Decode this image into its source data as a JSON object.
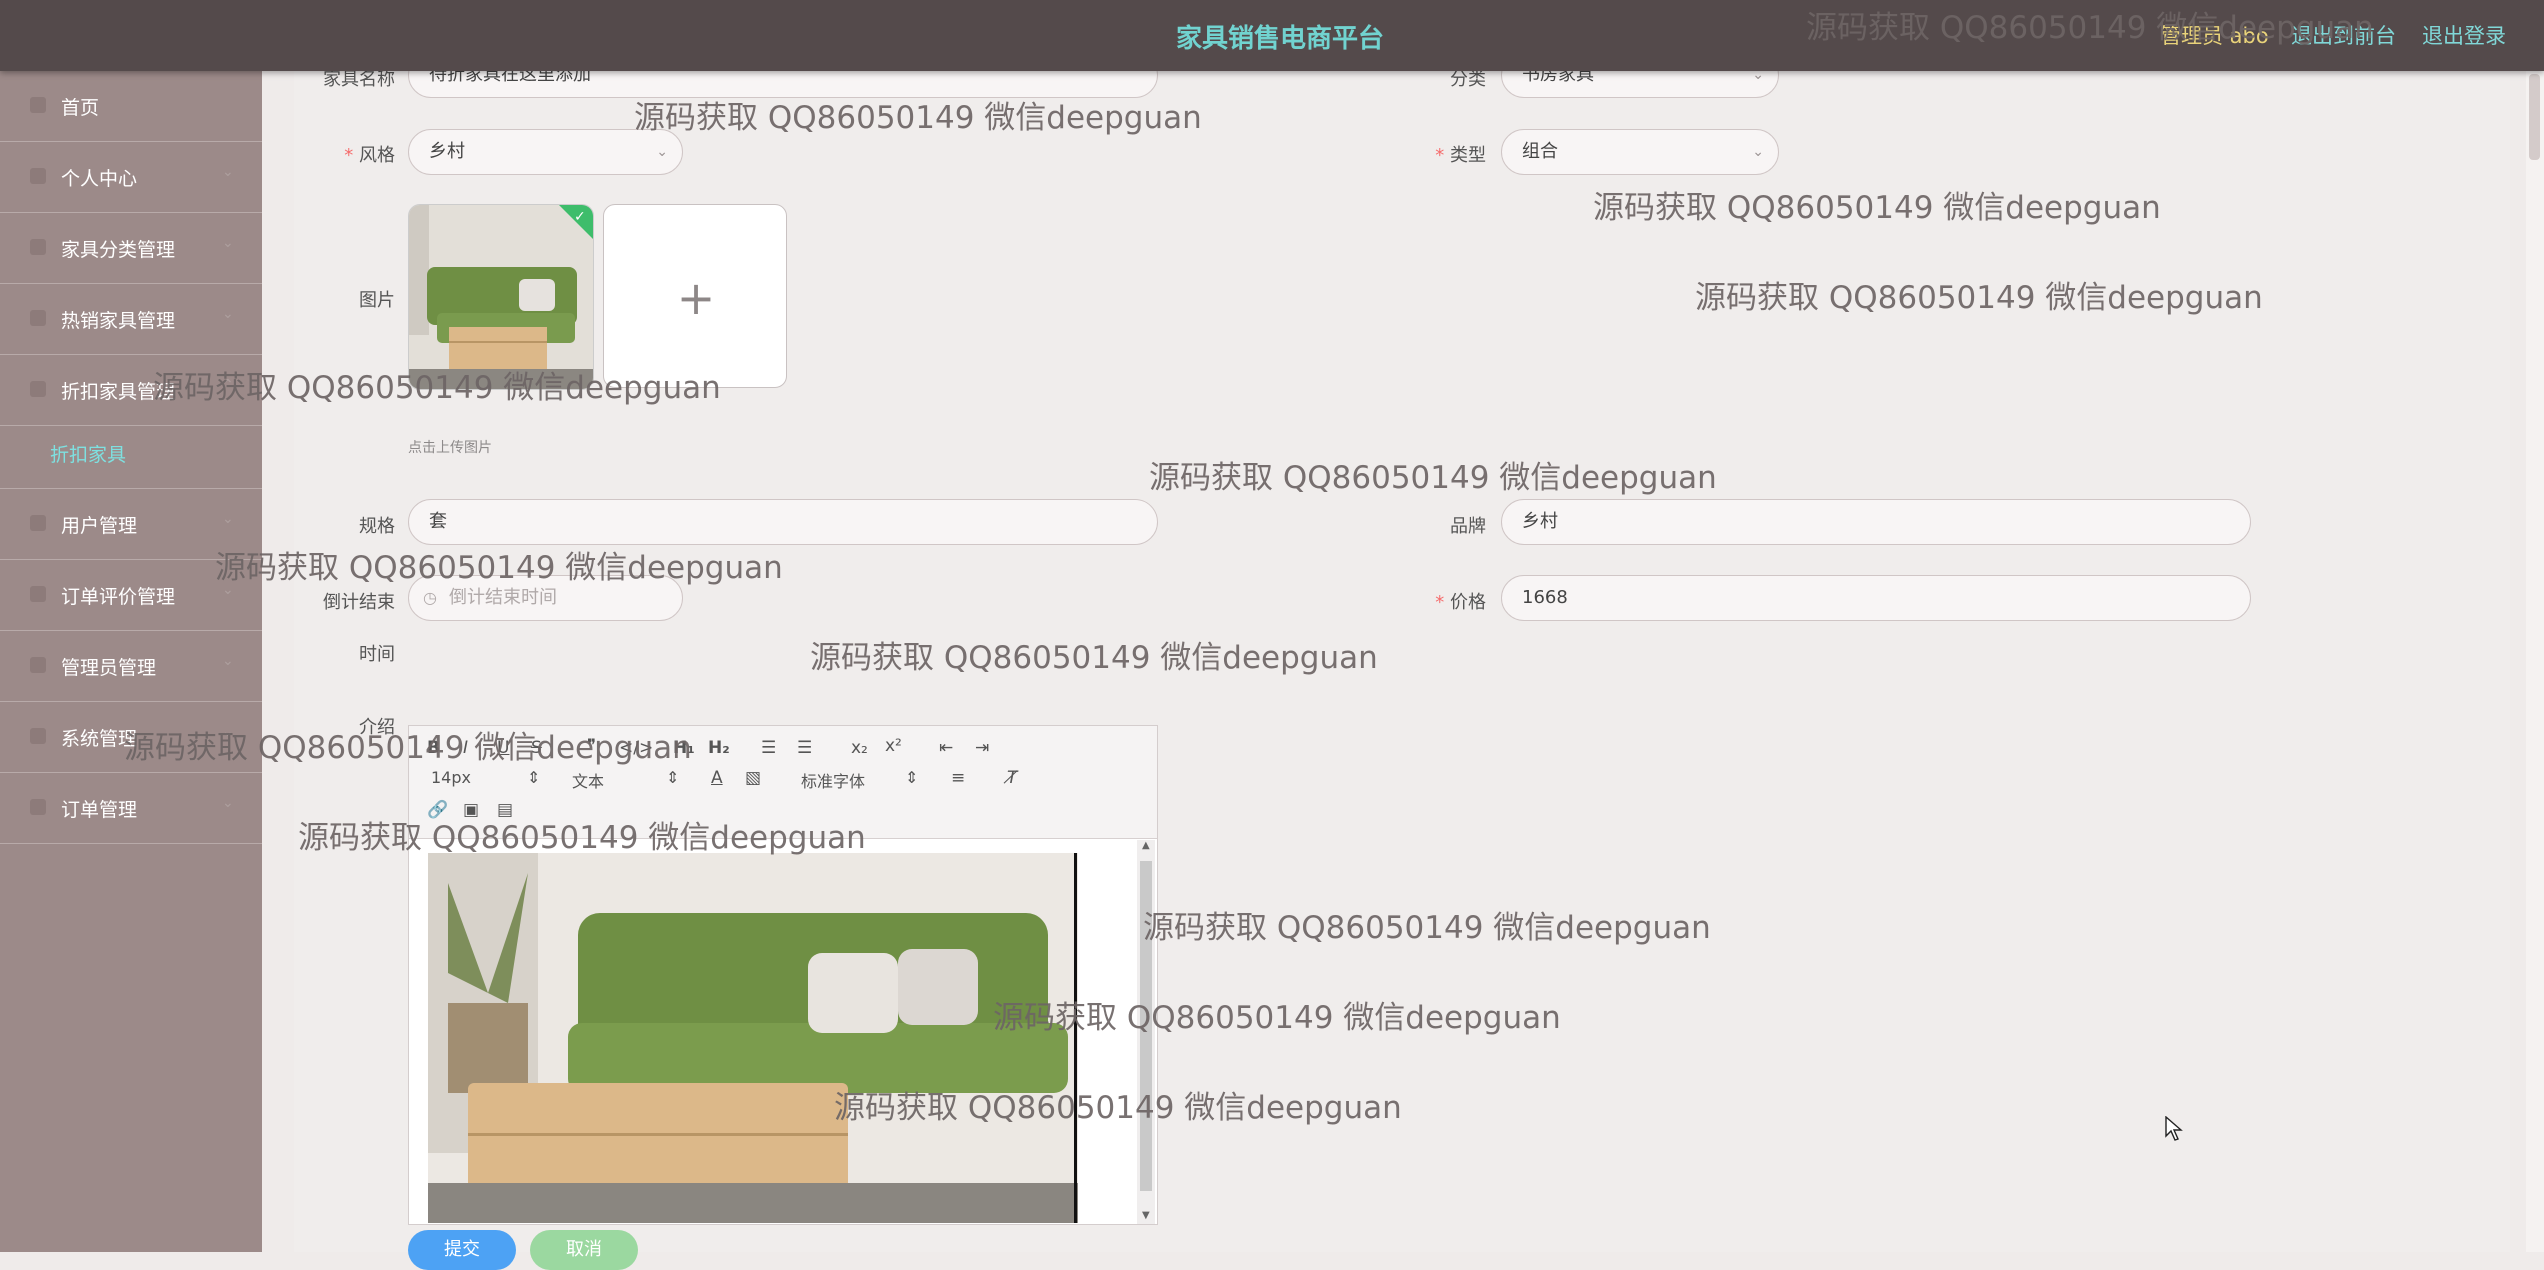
{
  "header": {
    "title": "家具销售电商平台",
    "admin": "管理员 abo",
    "back_to_front": "退出到前台",
    "logout": "退出登录"
  },
  "sidebar": {
    "items": [
      {
        "label": "首页",
        "icon": "home-icon"
      },
      {
        "label": "个人中心",
        "icon": "user-icon"
      },
      {
        "label": "家具分类管理",
        "icon": "list-icon"
      },
      {
        "label": "热销家具管理",
        "icon": "fire-icon"
      },
      {
        "label": "折扣家具管理",
        "icon": "tag-icon"
      },
      {
        "label": "用户管理",
        "icon": "user-icon"
      },
      {
        "label": "订单评价管理",
        "icon": "comment-icon"
      },
      {
        "label": "管理员管理",
        "icon": "admin-icon"
      },
      {
        "label": "系统管理",
        "icon": "gear-icon"
      },
      {
        "label": "订单管理",
        "icon": "send-icon"
      }
    ],
    "sub_item": "折扣家具"
  },
  "form": {
    "name_label": "家具名称",
    "name_value": "待折家具在这里添加",
    "category_label": "分类",
    "category_value": "书房家具",
    "style_label": "风格",
    "style_value": "乡村",
    "type_label": "类型",
    "type_value": "组合",
    "image_label": "图片",
    "upload_hint": "点击上传图片",
    "spec_label": "规格",
    "spec_value": "套",
    "brand_label": "品牌",
    "brand_value": "乡村",
    "countdown_label": "倒计结束",
    "countdown_label2": "时间",
    "countdown_placeholder": "倒计结束时间",
    "price_label": "价格",
    "price_value": "1668",
    "intro_label": "介绍",
    "required_mark": "*"
  },
  "editor": {
    "font_size": "14px",
    "text_style": "文本",
    "font_family": "标准字体"
  },
  "buttons": {
    "submit": "提交",
    "cancel": "取消"
  },
  "watermark": "源码获取 QQ86050149 微信deepguan"
}
